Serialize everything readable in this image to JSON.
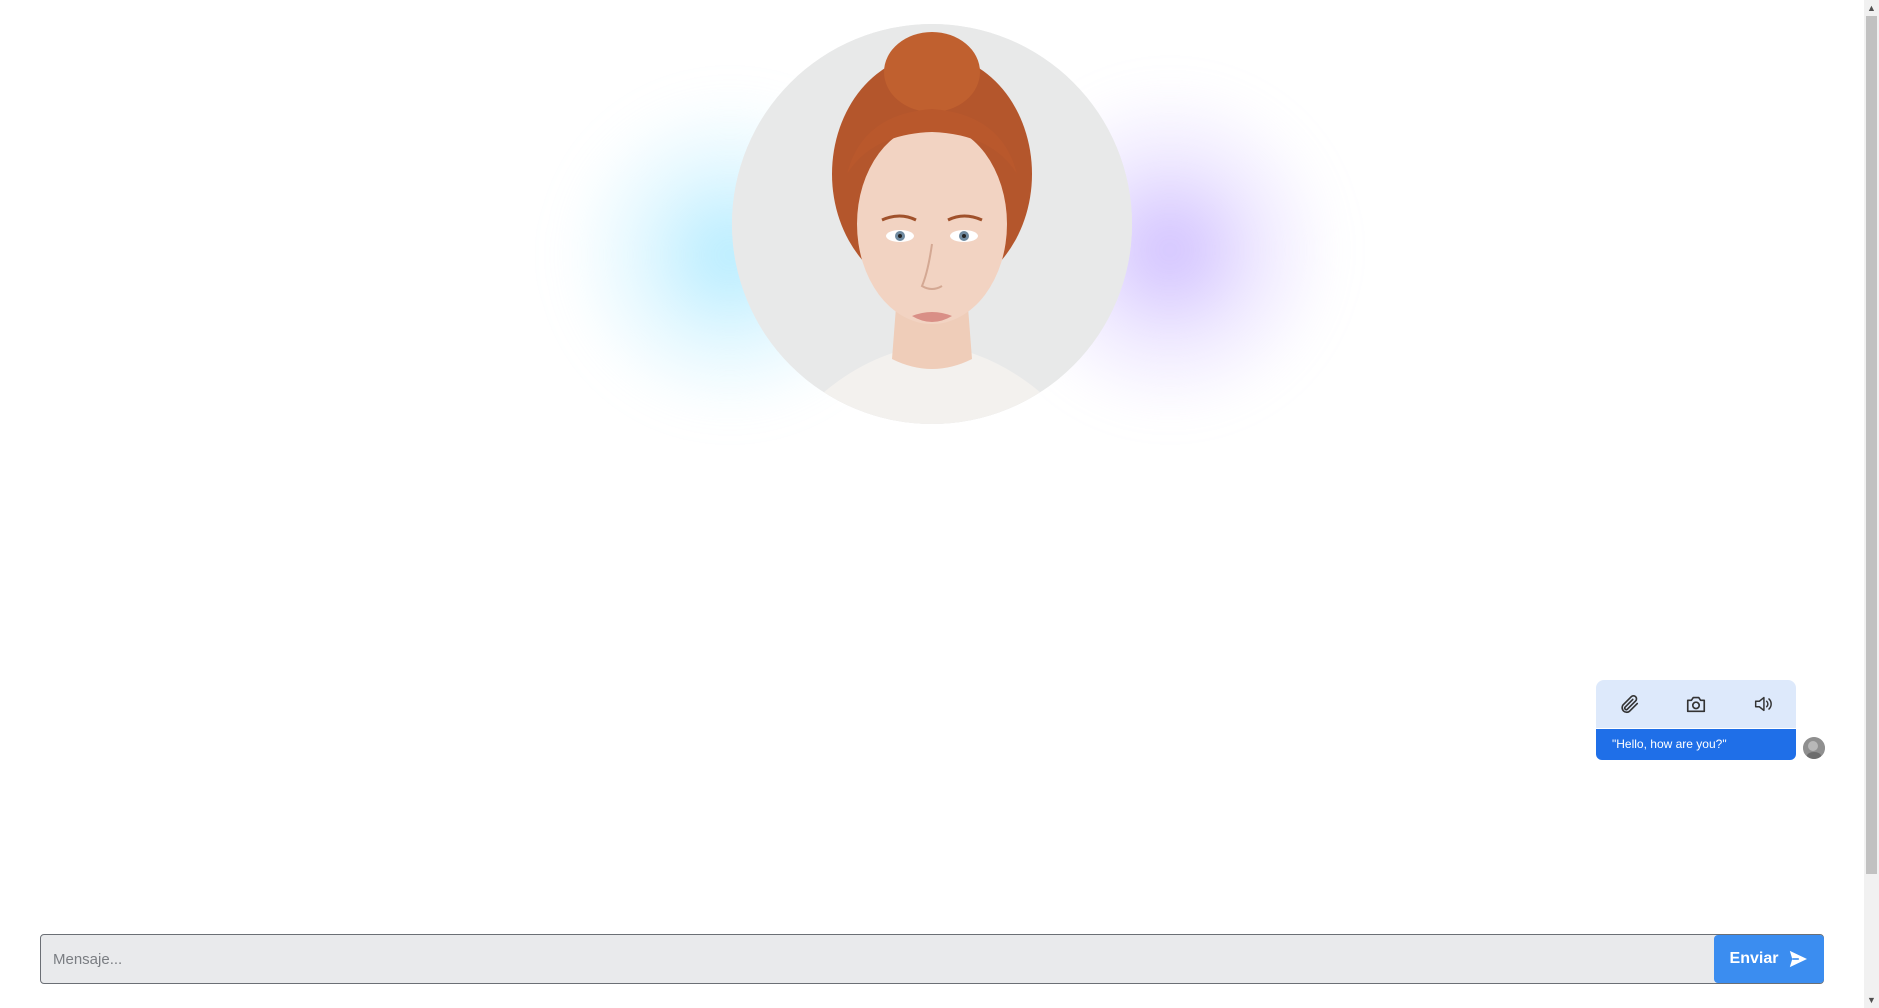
{
  "chat": {
    "message_bubble": "\"Hello, how are you?\"",
    "tools": [
      "paperclip-icon",
      "camera-icon",
      "speaker-icon"
    ]
  },
  "composer": {
    "placeholder": "Mensaje...",
    "send_label": "Enviar"
  },
  "colors": {
    "accent": "#3b8df0",
    "bubble": "#1f6fe8",
    "tools_bg": "#dde9fb"
  }
}
